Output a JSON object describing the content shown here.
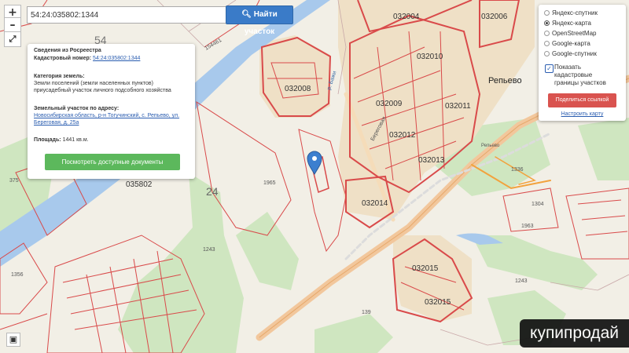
{
  "search": {
    "value": "54:24:035802:1344",
    "button_label": "Найти участок",
    "button_icon": "search-icon"
  },
  "zoom": {
    "in_label": "+",
    "out_label": "–",
    "fullscreen_icon": "expand-icon"
  },
  "info_panel": {
    "title": "Сведения из Росреестра",
    "cadastral_label": "Кадастровый номер:",
    "cadastral_number": "54:24:035802:1344",
    "category_label": "Категория земель:",
    "category_line1": "Земли поселений (земли населенных пунктов)",
    "category_line2": "приусадебный участок личного подсобного хозяйства",
    "address_label": "Земельный участок по адресу:",
    "address_line1": "Новосибирская область, р-н Тогучинский, с. Репьево, ул.",
    "address_line2": "Береговая, д. 25а",
    "area_label": "Площадь:",
    "area_value": "1441 кв.м.",
    "docs_button": "Посмотреть доступные документы"
  },
  "layers": {
    "options": [
      {
        "label": "Яндекс-спутник",
        "selected": false
      },
      {
        "label": "Яндекс-карта",
        "selected": true
      },
      {
        "label": "OpenStreetMap",
        "selected": false
      },
      {
        "label": "Google-карта",
        "selected": false
      },
      {
        "label": "Google-спутник",
        "selected": false
      }
    ],
    "cadastral_checked": true,
    "cadastral_line1": "Показать",
    "cadastral_line2": "кадастровые",
    "cadastral_line3": "границы участков",
    "share_button": "Поделиться ссылкой",
    "configure_link": "Настроить карту"
  },
  "map_labels": {
    "q_032006": "032006",
    "q_032004": "032004",
    "q_032010": "032010",
    "q_032008": "032008",
    "q_032009": "032009",
    "q_032011": "032011",
    "q_032012": "032012",
    "q_032013": "032013",
    "q_032014": "032014",
    "q_032015": "032015",
    "q_032015b": "032015",
    "q_035802": "035802",
    "village": "Репьево",
    "n_54": "54",
    "n_24": "24",
    "n_1965": "1965",
    "n_1963": "1963",
    "n_1243": "1243",
    "n_1243b": "1243",
    "n_1356": "1356",
    "n_1304": "1304",
    "n_1336": "1336",
    "n_375": "375",
    "n_139": "139",
    "n_154461": "154461",
    "station": "Репьево",
    "street_beregovaya": "Береговая",
    "street_river": "р. Бажи"
  },
  "marker_icon": "map-pin-icon",
  "layers_icon": "layers-icon",
  "watermark": "купипродай",
  "colors": {
    "map_bg": "#f2efe6",
    "green": "#cfe6c0",
    "water": "#a8c9ec",
    "road": "#f2c79c",
    "cadastre": "#d94a4a",
    "primary_button": "#3a7bc8",
    "docs_button": "#5cb85c",
    "share_button": "#d9534f"
  }
}
